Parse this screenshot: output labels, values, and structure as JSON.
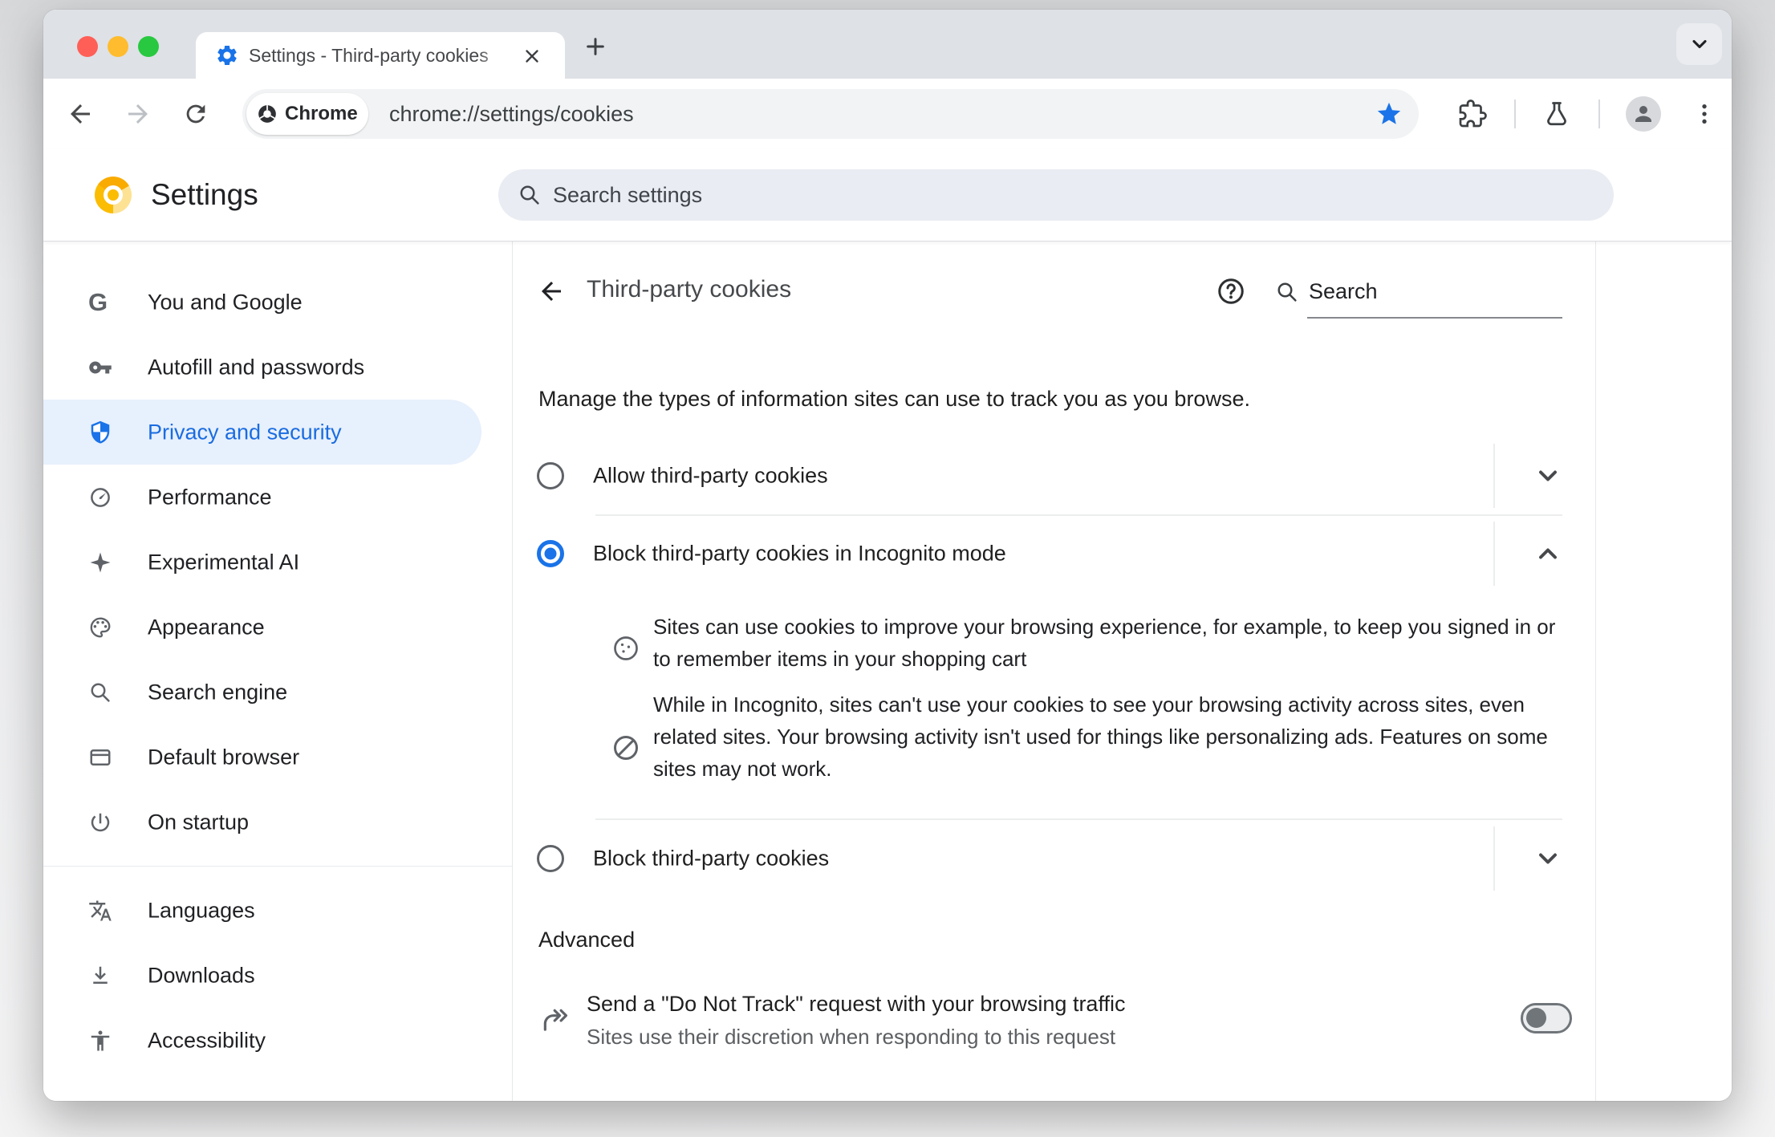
{
  "tab_strip": {
    "tab_title": "Settings - Third-party cookies"
  },
  "toolbar": {
    "url_chip_label": "Chrome",
    "url": "chrome://settings/cookies"
  },
  "settings_header": {
    "title": "Settings",
    "search_placeholder": "Search settings"
  },
  "sidebar": {
    "items": [
      {
        "label": "You and Google",
        "icon": "google-g",
        "selected": false
      },
      {
        "label": "Autofill and passwords",
        "icon": "key",
        "selected": false
      },
      {
        "label": "Privacy and security",
        "icon": "shield",
        "selected": true
      },
      {
        "label": "Performance",
        "icon": "speedometer",
        "selected": false
      },
      {
        "label": "Experimental AI",
        "icon": "sparkle",
        "selected": false
      },
      {
        "label": "Appearance",
        "icon": "palette",
        "selected": false
      },
      {
        "label": "Search engine",
        "icon": "magnifier",
        "selected": false
      },
      {
        "label": "Default browser",
        "icon": "browser-window",
        "selected": false
      },
      {
        "label": "On startup",
        "icon": "power",
        "selected": false
      },
      {
        "label": "Languages",
        "icon": "translate",
        "selected": false
      },
      {
        "label": "Downloads",
        "icon": "download",
        "selected": false
      },
      {
        "label": "Accessibility",
        "icon": "accessibility",
        "selected": false
      }
    ]
  },
  "content": {
    "page_title": "Third-party cookies",
    "search_placeholder": "Search",
    "intro": "Manage the types of information sites can use to track you as you browse.",
    "options": [
      {
        "label": "Allow third-party cookies",
        "selected": false,
        "expanded": false
      },
      {
        "label": "Block third-party cookies in Incognito mode",
        "selected": true,
        "expanded": true
      },
      {
        "label": "Block third-party cookies",
        "selected": false,
        "expanded": false
      }
    ],
    "expanded_details": [
      {
        "icon": "cookie",
        "text": "Sites can use cookies to improve your browsing experience, for example, to keep you signed in or to remember items in your shopping cart"
      },
      {
        "icon": "blocked",
        "text": "While in Incognito, sites can't use your cookies to see your browsing activity across sites, even related sites. Your browsing activity isn't used for things like personalizing ads. Features on some sites may not work."
      }
    ],
    "advanced_label": "Advanced",
    "do_not_track": {
      "title": "Send a \"Do Not Track\" request with your browsing traffic",
      "subtitle": "Sites use their discretion when responding to this request",
      "enabled": false
    }
  },
  "colors": {
    "accent_blue": "#1a73e8",
    "selected_item_bg": "#e7f0fd",
    "canary_yellow": "#fbbc04",
    "traffic_red": "#ff5f57",
    "traffic_yellow": "#febc2e",
    "traffic_green": "#28c840",
    "tabstrip_bg": "#dee1e6",
    "omnibox_bg": "#f1f3f4",
    "settings_search_bg": "#e9ecf2"
  }
}
